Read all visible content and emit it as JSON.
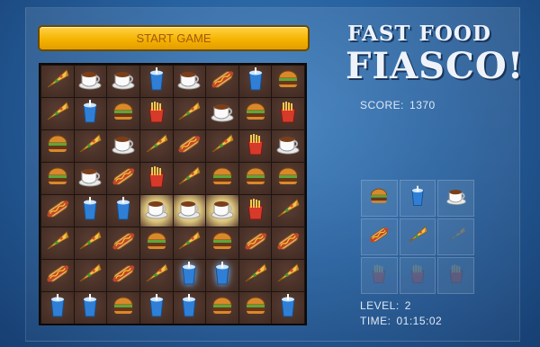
{
  "start_button": {
    "label": "START GAME"
  },
  "title": {
    "line1": "FAST FOOD",
    "line2": "FIASCO!"
  },
  "score": {
    "label": "SCORE:",
    "value": "1370"
  },
  "level": {
    "label": "LEVEL:",
    "value": "2"
  },
  "time": {
    "label": "TIME:",
    "value": "01:15:02"
  },
  "board": {
    "rows": [
      [
        "pizza",
        "coffee",
        "coffee",
        "soda",
        "coffee",
        "hotdog",
        "soda",
        "burger"
      ],
      [
        "pizza",
        "soda",
        "burger",
        "fries",
        "pizza",
        "coffee",
        "burger",
        "fries"
      ],
      [
        "burger",
        "pizza",
        "coffee",
        "pizza",
        "hotdog",
        "pizza",
        "fries",
        "coffee"
      ],
      [
        "burger",
        "coffee",
        "hotdog",
        "fries",
        "pizza",
        "burger",
        "burger",
        "burger"
      ],
      [
        "hotdog",
        "soda",
        "soda",
        "coffee-hl",
        "coffee-hl",
        "coffee-hl",
        "fries",
        "pizza"
      ],
      [
        "pizza",
        "pizza",
        "hotdog",
        "burger",
        "pizza",
        "burger",
        "hotdog",
        "hotdog"
      ],
      [
        "hotdog",
        "pizza",
        "hotdog",
        "pizza",
        "soda-glow",
        "soda-glow",
        "pizza",
        "pizza"
      ],
      [
        "soda",
        "soda",
        "burger",
        "soda",
        "soda",
        "burger",
        "burger",
        "soda"
      ]
    ]
  },
  "preview": {
    "items": [
      {
        "icon": "burger",
        "dim": false
      },
      {
        "icon": "soda",
        "dim": false
      },
      {
        "icon": "coffee",
        "dim": false
      },
      {
        "icon": "hotdog",
        "dim": false
      },
      {
        "icon": "pizza",
        "dim": false
      },
      {
        "icon": "pizza",
        "dim": true
      },
      {
        "icon": "fries",
        "dim": true
      },
      {
        "icon": "fries",
        "dim": true
      },
      {
        "icon": "fries",
        "dim": true
      }
    ]
  },
  "colors": {
    "button": "#f5b400",
    "board_bg": "#3f2a22",
    "text": "#dfe8f5"
  }
}
